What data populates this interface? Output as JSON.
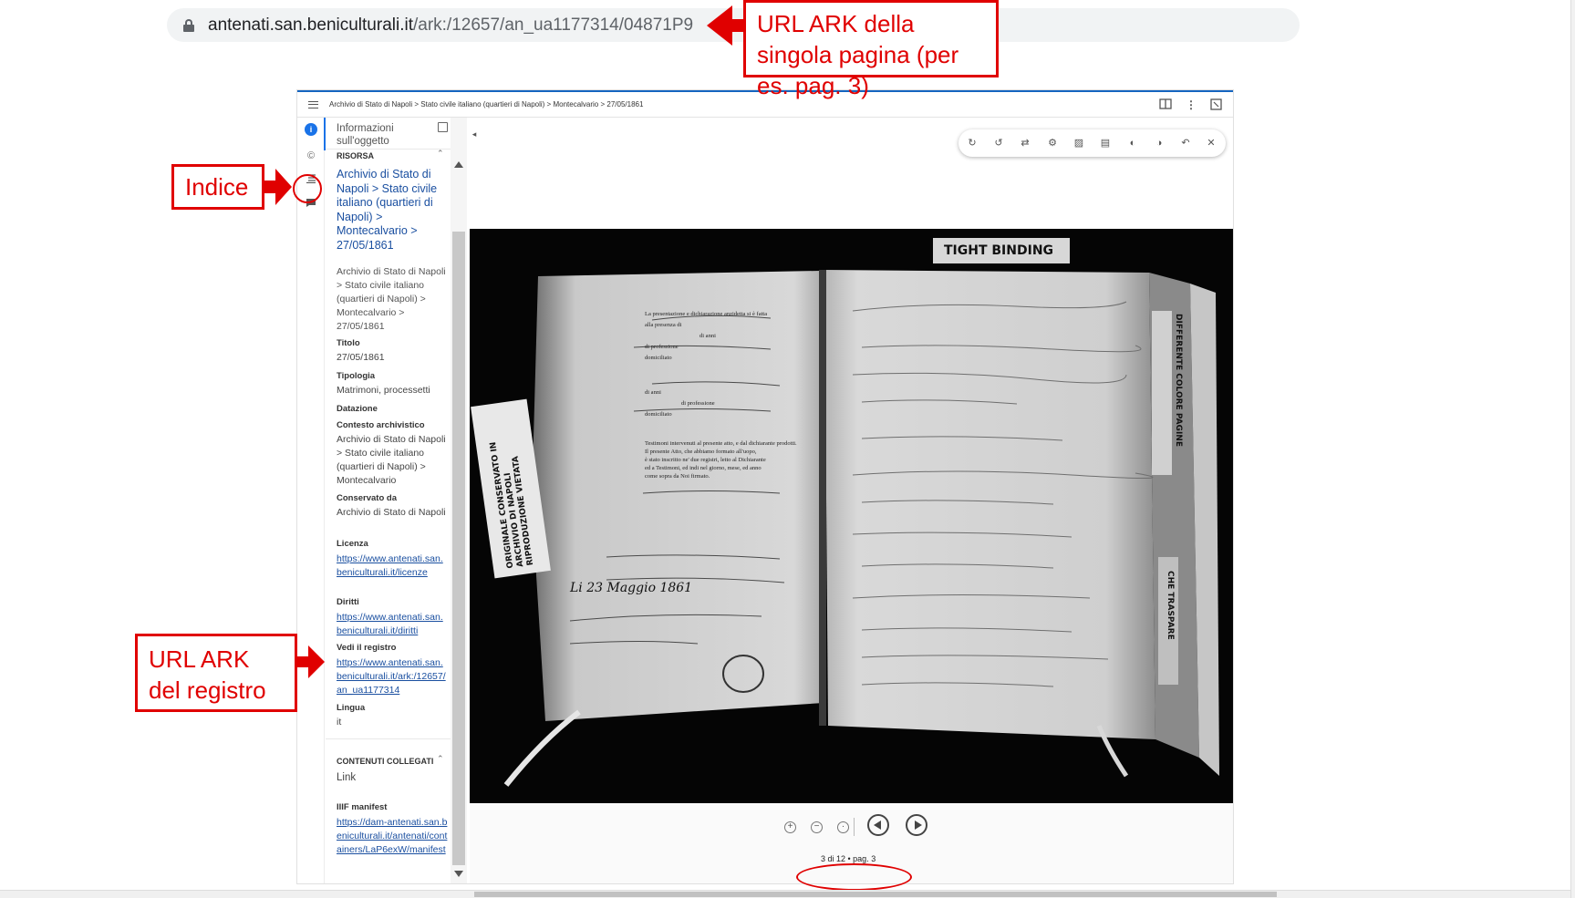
{
  "browser": {
    "url_domain": "antenati.san.beniculturali.it",
    "url_path": "/ark:/12657/an_ua1177314/04871P9"
  },
  "viewer": {
    "breadcrumb": "Archivio di Stato di Napoli > Stato civile italiano (quartieri di Napoli) > Montecalvario > 27/05/1861",
    "panel": {
      "header": "Informazioni sull'oggetto",
      "section_resource": "RISORSA",
      "resource_title": "Archivio di Stato di Napoli > Stato civile italiano (quartieri di Napoli) > Montecalvario > 27/05/1861",
      "resource_desc": "Archivio di Stato di Napoli > Stato civile italiano (quartieri di Napoli) > Montecalvario > 27/05/1861",
      "fields": [
        {
          "label": "Titolo",
          "value": "27/05/1861"
        },
        {
          "label": "Tipologia",
          "value": "Matrimoni, processetti"
        },
        {
          "label": "Datazione",
          "value": ""
        },
        {
          "label": "Contesto archivistico",
          "value": "Archivio di Stato di Napoli > Stato civile italiano (quartieri di Napoli) > Montecalvario"
        },
        {
          "label": "Conservato da",
          "value": "Archivio di Stato di Napoli"
        },
        {
          "label": "Licenza",
          "value": "https://www.antenati.san.beniculturali.it/licenze"
        },
        {
          "label": "Diritti",
          "value": "https://www.antenati.san.beniculturali.it/diritti"
        },
        {
          "label": "Vedi il registro",
          "value": "https://www.antenati.san.beniculturali.it/ark:/12657/an_ua1177314"
        },
        {
          "label": "Lingua",
          "value": "it"
        }
      ],
      "section_related": "CONTENUTI COLLEGATI",
      "related_link": "Link",
      "iiif_label": "IIIF manifest",
      "iiif_url": "https://dam-antenati.san.beniculturali.it/antenati/containers/LaP6exW/manifest"
    },
    "page_indicator": "3 di 12 • pag. 3",
    "document_image": {
      "stamp_text": "TIGHT BINDING",
      "vertical_left": "ORIGINALE CONSERVATO IN ARCHIVIO DI NAPOLI RIPRODUZIONE VIETATA",
      "vertical_right": "DIFFERENTE COLORE PAGINE",
      "vertical_right_bottom": "CHE TRASPARE",
      "print_lines": [
        "La presentazione e dichiarazione anzidetta si è fatta",
        "alla presenza di",
        "di anni",
        "di professione",
        "domiciliato",
        "di anni",
        "di professione",
        "domiciliato",
        "Testimoni intervenuti al presente atto, e dal dichiarante prodotti.",
        "Il presente Atto, che abbiamo formato all'uopo,",
        "è stato inscritto ne' due registri, letto al Dichiarante",
        "ed a Testimoni, ed indi nel giorno, mese, ed anno",
        "come sopra da Noi firmato."
      ],
      "handwritten_date": "Li 23 Maggio 1861"
    }
  },
  "annotations": {
    "url_callout": "URL ARK della singola pagina (per es. pag. 3)",
    "index_callout": "Indice",
    "register_callout": "URL ARK del registro"
  },
  "colors": {
    "annotation_red": "#e00000",
    "link_blue": "#1a4fa0",
    "accent_blue": "#1a73e8"
  }
}
